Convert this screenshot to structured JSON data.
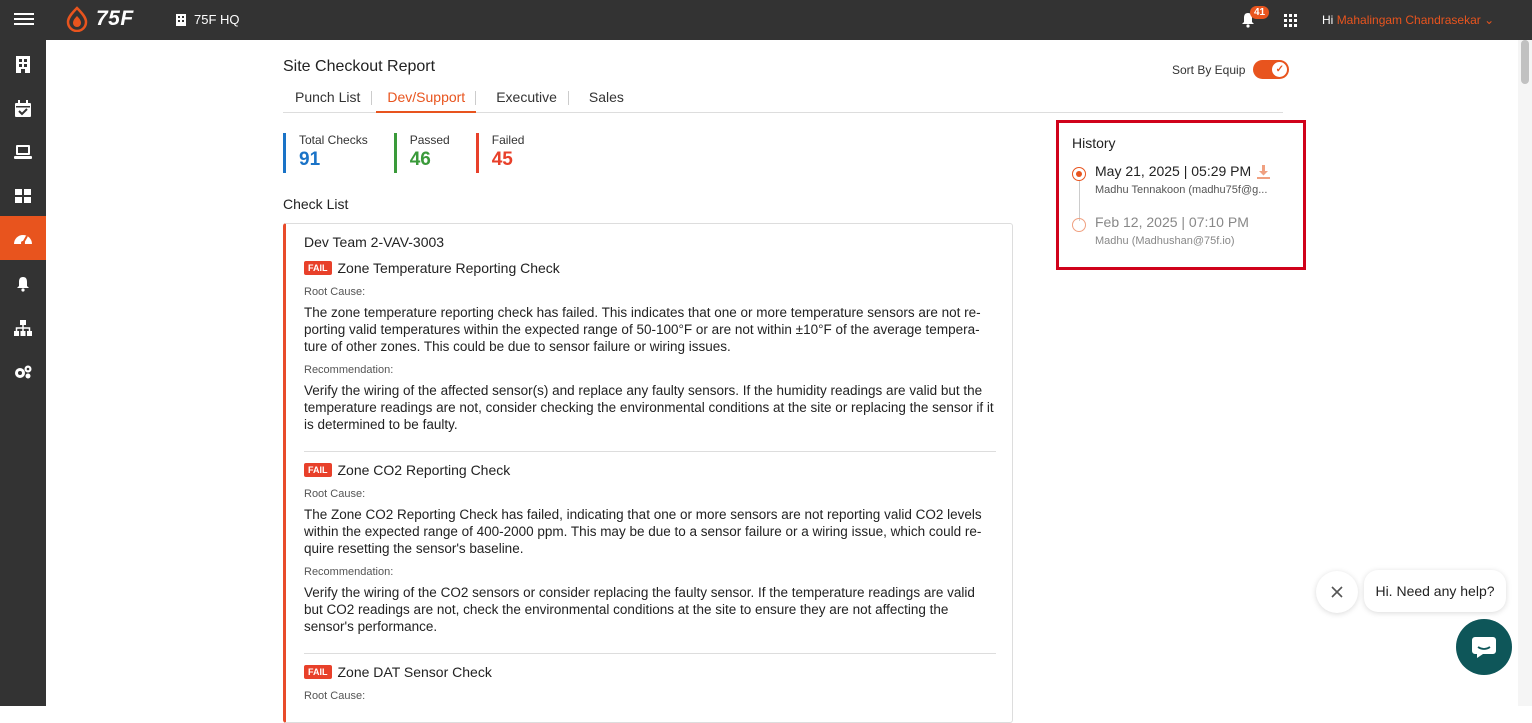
{
  "header": {
    "logo_text": "75F",
    "site_name": "75F HQ",
    "notification_count": "41",
    "greeting": "Hi",
    "user_name": "Mahalingam Chandrasekar"
  },
  "sidebar": {
    "items": [
      {
        "icon": "building-icon"
      },
      {
        "icon": "calendar-check-icon"
      },
      {
        "icon": "laptop-icon"
      },
      {
        "icon": "dashboard-icon"
      },
      {
        "icon": "speedometer-icon",
        "active": true
      },
      {
        "icon": "bell-icon"
      },
      {
        "icon": "hierarchy-icon"
      },
      {
        "icon": "settings-icon"
      }
    ]
  },
  "page": {
    "title": "Site Checkout Report",
    "sort_label": "Sort By Equip",
    "sort_enabled": true,
    "tabs": [
      "Punch List",
      "Dev/Support",
      "Executive",
      "Sales"
    ],
    "active_tab": "Dev/Support"
  },
  "stats": {
    "total_label": "Total Checks",
    "total_value": "91",
    "passed_label": "Passed",
    "passed_value": "46",
    "failed_label": "Failed",
    "failed_value": "45"
  },
  "checklist": {
    "title": "Check List",
    "equipment": "Dev Team 2-VAV-3003",
    "fail_tag": "FAIL",
    "root_cause_label": "Root Cause:",
    "recommendation_label": "Recommendation:",
    "checks": [
      {
        "name": "Zone Temperature Reporting Check",
        "root_cause": "The zone temperature reporting check has failed. This indicates that one or more temperature sensors are not re-porting valid temperatures within the expected range of 50-100°F or are not within ±10°F of the average tempera-ture of other zones. This could be due to sensor failure or wiring issues.",
        "recommendation": "Verify the wiring of the affected sensor(s) and replace any faulty sensors. If the humidity readings are valid but the temperature readings are not, consider checking the environmental conditions at the site or replacing the sensor if it is determined to be faulty."
      },
      {
        "name": "Zone CO2 Reporting Check",
        "root_cause": "The Zone CO2 Reporting Check has failed, indicating that one or more sensors are not reporting valid CO2 levels within the expected range of 400-2000 ppm. This may be due to a sensor failure or a wiring issue, which could re-quire resetting the sensor's baseline.",
        "recommendation": "Verify the wiring of the CO2 sensors or consider replacing the faulty sensor. If the temperature readings are valid but CO2 readings are not, check the environmental conditions at the site to ensure they are not affecting the sensor's performance."
      },
      {
        "name": "Zone DAT Sensor Check",
        "root_cause": "",
        "recommendation": ""
      }
    ]
  },
  "history": {
    "title": "History",
    "entries": [
      {
        "date": "May 21, 2025 | 05:29 PM",
        "user": "Madhu Tennakoon (madhu75f@g...",
        "selected": true
      },
      {
        "date": "Feb 12, 2025 | 07:10 PM",
        "user": "Madhu (Madhushan@75f.io)",
        "selected": false
      }
    ]
  },
  "chat": {
    "help_text": "Hi. Need any help?"
  },
  "colors": {
    "accent": "#e8541e",
    "total": "#1a73c7",
    "passed": "#3a9a3a",
    "failed": "#e8402a",
    "header_bg": "#333333",
    "chat_bg": "#0e5659"
  }
}
